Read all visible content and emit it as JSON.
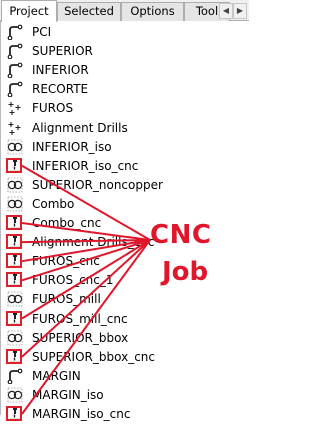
{
  "tabs": [
    {
      "label": "Project",
      "active": true
    },
    {
      "label": "Selected",
      "active": false
    },
    {
      "label": "Options",
      "active": false
    },
    {
      "label": "Tool",
      "active": false
    }
  ],
  "objects": [
    {
      "label": "PCI",
      "icon": "gerber-icon"
    },
    {
      "label": "SUPERIOR",
      "icon": "gerber-icon"
    },
    {
      "label": "INFERIOR",
      "icon": "gerber-icon"
    },
    {
      "label": "RECORTE",
      "icon": "gerber-icon"
    },
    {
      "label": "FUROS",
      "icon": "drills-icon"
    },
    {
      "label": "Alignment Drills",
      "icon": "drills-icon"
    },
    {
      "label": "INFERIOR_iso",
      "icon": "geometry-icon"
    },
    {
      "label": "INFERIOR_iso_cnc",
      "icon": "cnc-icon"
    },
    {
      "label": "SUPERIOR_noncopper",
      "icon": "geometry-icon"
    },
    {
      "label": "Combo",
      "icon": "geometry-icon"
    },
    {
      "label": "Combo_cnc",
      "icon": "cnc-icon"
    },
    {
      "label": "Alignment Drills_cnc",
      "icon": "cnc-icon"
    },
    {
      "label": "FUROS_cnc",
      "icon": "cnc-icon"
    },
    {
      "label": "FUROS_cnc_1",
      "icon": "cnc-icon"
    },
    {
      "label": "FUROS_mill",
      "icon": "geometry-icon"
    },
    {
      "label": "FUROS_mill_cnc",
      "icon": "cnc-icon"
    },
    {
      "label": "SUPERIOR_bbox",
      "icon": "geometry-icon"
    },
    {
      "label": "SUPERIOR_bbox_cnc",
      "icon": "cnc-icon"
    },
    {
      "label": "MARGIN",
      "icon": "gerber-icon"
    },
    {
      "label": "MARGIN_iso",
      "icon": "geometry-icon"
    },
    {
      "label": "MARGIN_iso_cnc",
      "icon": "cnc-icon"
    }
  ],
  "annotation": {
    "line1": "CNC",
    "line2": "Job",
    "color": "#e0162b"
  }
}
